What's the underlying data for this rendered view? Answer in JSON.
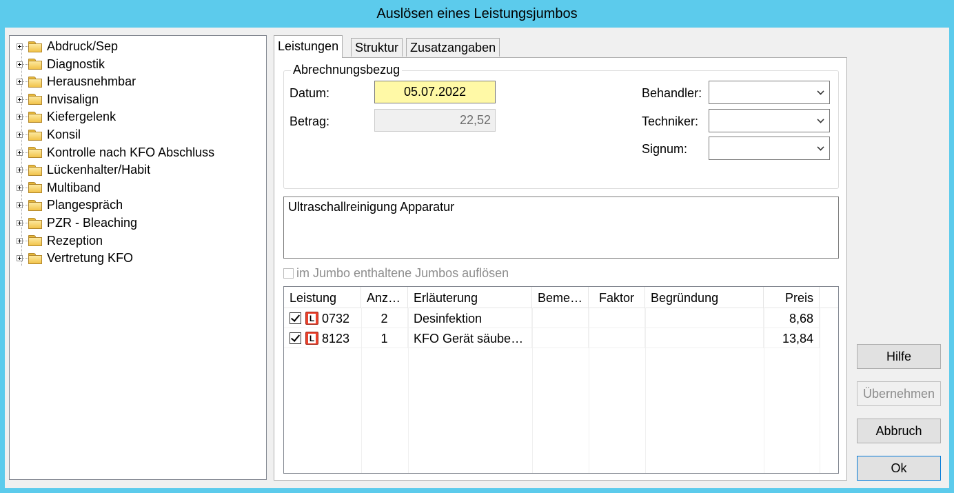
{
  "window": {
    "title": "Auslösen eines Leistungsjumbos"
  },
  "tree": {
    "items": [
      {
        "label": "Abdruck/Sep"
      },
      {
        "label": "Diagnostik"
      },
      {
        "label": "Herausnehmbar"
      },
      {
        "label": "Invisalign"
      },
      {
        "label": "Kiefergelenk"
      },
      {
        "label": "Konsil"
      },
      {
        "label": "Kontrolle nach KFO Abschluss"
      },
      {
        "label": "Lückenhalter/Habit"
      },
      {
        "label": "Multiband"
      },
      {
        "label": "Plangespräch"
      },
      {
        "label": "PZR - Bleaching"
      },
      {
        "label": "Rezeption"
      },
      {
        "label": "Vertretung KFO"
      }
    ]
  },
  "tabs": [
    {
      "label": "Leistungen",
      "active": true
    },
    {
      "label": "Struktur",
      "active": false
    },
    {
      "label": "Zusatzangaben",
      "active": false
    }
  ],
  "billing": {
    "group_title": "Abrechnungsbezug",
    "date_label": "Datum:",
    "date_value": "05.07.2022",
    "amount_label": "Betrag:",
    "amount_value": "22,52",
    "behandler_label": "Behandler:",
    "behandler_value": "",
    "techniker_label": "Techniker:",
    "techniker_value": "",
    "signum_label": "Signum:",
    "signum_value": ""
  },
  "description": "Ultraschallreinigung Apparatur",
  "resolve_checkbox": {
    "label": "im Jumbo enthaltene Jumbos auflösen",
    "checked": false,
    "enabled": false
  },
  "grid": {
    "columns": [
      "Leistung",
      "Anz…",
      "Erläuterung",
      "Beme…",
      "Faktor",
      "Begründung",
      "Preis"
    ],
    "rows": [
      {
        "checked": true,
        "icon": "L",
        "code": "0732",
        "count": "2",
        "explanation": "Desinfektion",
        "remark": "",
        "factor": "",
        "reason": "",
        "price": "8,68"
      },
      {
        "checked": true,
        "icon": "L",
        "code": "8123",
        "count": "1",
        "explanation": "KFO Gerät säube…",
        "remark": "",
        "factor": "",
        "reason": "",
        "price": "13,84"
      }
    ]
  },
  "buttons": {
    "help": "Hilfe",
    "apply": "Übernehmen",
    "cancel": "Abbruch",
    "ok": "Ok"
  },
  "colors": {
    "titlebar": "#5ccbec",
    "date_field_bg": "#fff9a6",
    "service_icon": "#e8412c"
  }
}
